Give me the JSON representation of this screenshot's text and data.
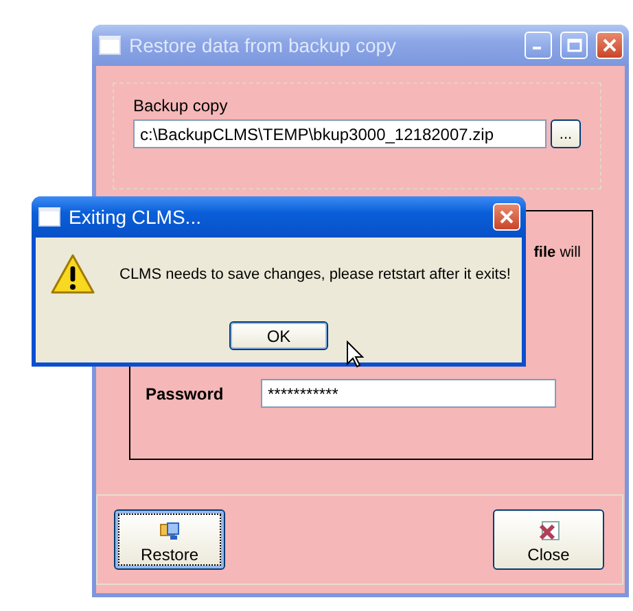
{
  "main_window": {
    "title": "Restore data from backup copy",
    "backup_label": "Backup copy",
    "backup_path": "c:\\BackupCLMS\\TEMP\\bkup3000_12182007.zip",
    "browse_button": "...",
    "note_fragment": "**file** will",
    "password_label": "Password",
    "password_value": "***********",
    "buttons": [
      {
        "kind": "restore",
        "label": "Restore",
        "focused": true
      },
      {
        "kind": "close",
        "label": "Close",
        "focused": false
      }
    ]
  },
  "dialog": {
    "title": "Exiting CLMS...",
    "kind": "warning",
    "message": "CLMS needs to save changes, please retstart after it exits!",
    "buttons": [
      {
        "label": "OK"
      }
    ]
  }
}
